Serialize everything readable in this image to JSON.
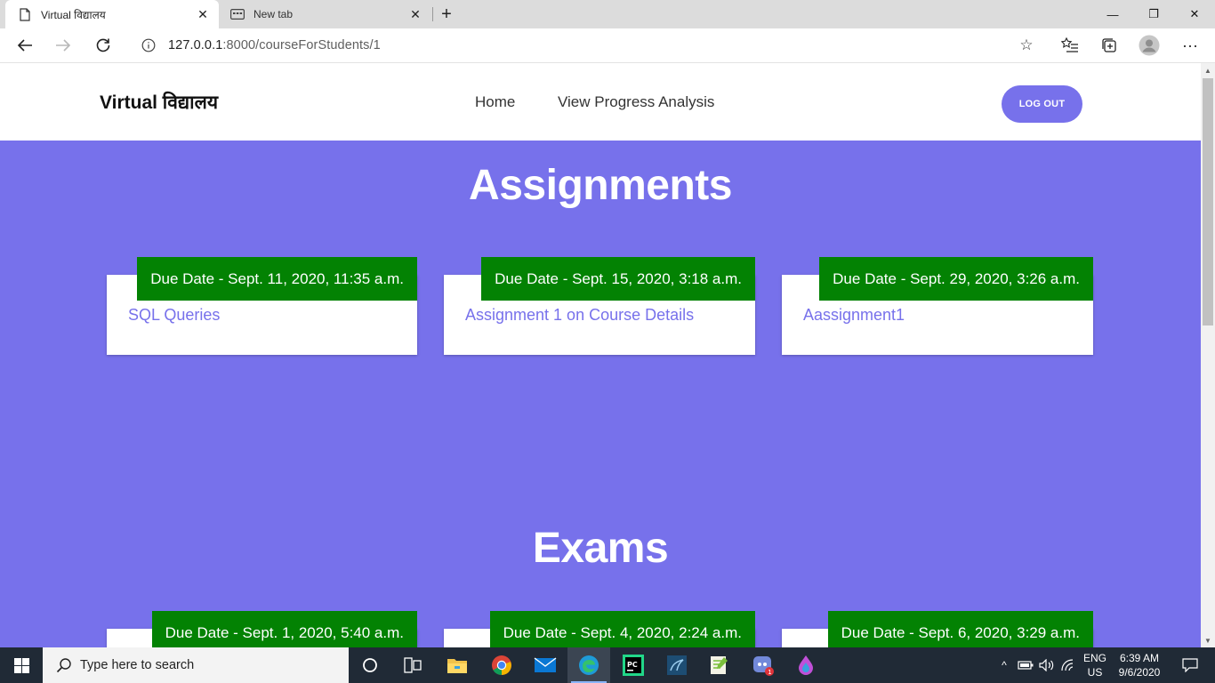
{
  "browser": {
    "tabs": [
      {
        "title": "Virtual विद्यालय",
        "active": true
      },
      {
        "title": "New tab",
        "active": false
      }
    ],
    "new_tab_label": "+",
    "window_controls": {
      "minimize": "—",
      "restore": "❐",
      "close": "✕"
    },
    "url_host": "127.0.0.1",
    "url_rest": ":8000/courseForStudents/1"
  },
  "site": {
    "brand": "Virtual विद्यालय",
    "nav": [
      {
        "label": "Home"
      },
      {
        "label": "View Progress Analysis"
      }
    ],
    "logout_label": "LOG OUT",
    "accent_color": "#7771eb",
    "due_color": "#038203"
  },
  "assignments": {
    "title": "Assignments",
    "items": [
      {
        "due": "Due Date - Sept. 11, 2020, 11:35 a.m.",
        "name": "SQL Queries"
      },
      {
        "due": "Due Date - Sept. 15, 2020, 3:18 a.m.",
        "name": "Assignment 1 on Course Details"
      },
      {
        "due": "Due Date - Sept. 29, 2020, 3:26 a.m.",
        "name": "Aassignment1"
      }
    ]
  },
  "exams": {
    "title": "Exams",
    "items": [
      {
        "due": "Due Date - Sept. 1, 2020, 5:40 a.m."
      },
      {
        "due": "Due Date - Sept. 4, 2020, 2:24 a.m."
      },
      {
        "due": "Due Date - Sept. 6, 2020, 3:29 a.m."
      }
    ]
  },
  "taskbar": {
    "search_placeholder": "Type here to search",
    "language": {
      "line1": "ENG",
      "line2": "US"
    },
    "clock": {
      "time": "6:39 AM",
      "date": "9/6/2020"
    },
    "apps": [
      "cortana-icon",
      "task-view-icon",
      "file-explorer-icon",
      "chrome-icon",
      "mail-icon",
      "edge-icon",
      "pycharm-icon",
      "mysql-workbench-icon",
      "notepad-plus-icon",
      "discord-icon",
      "paint-icon"
    ]
  }
}
